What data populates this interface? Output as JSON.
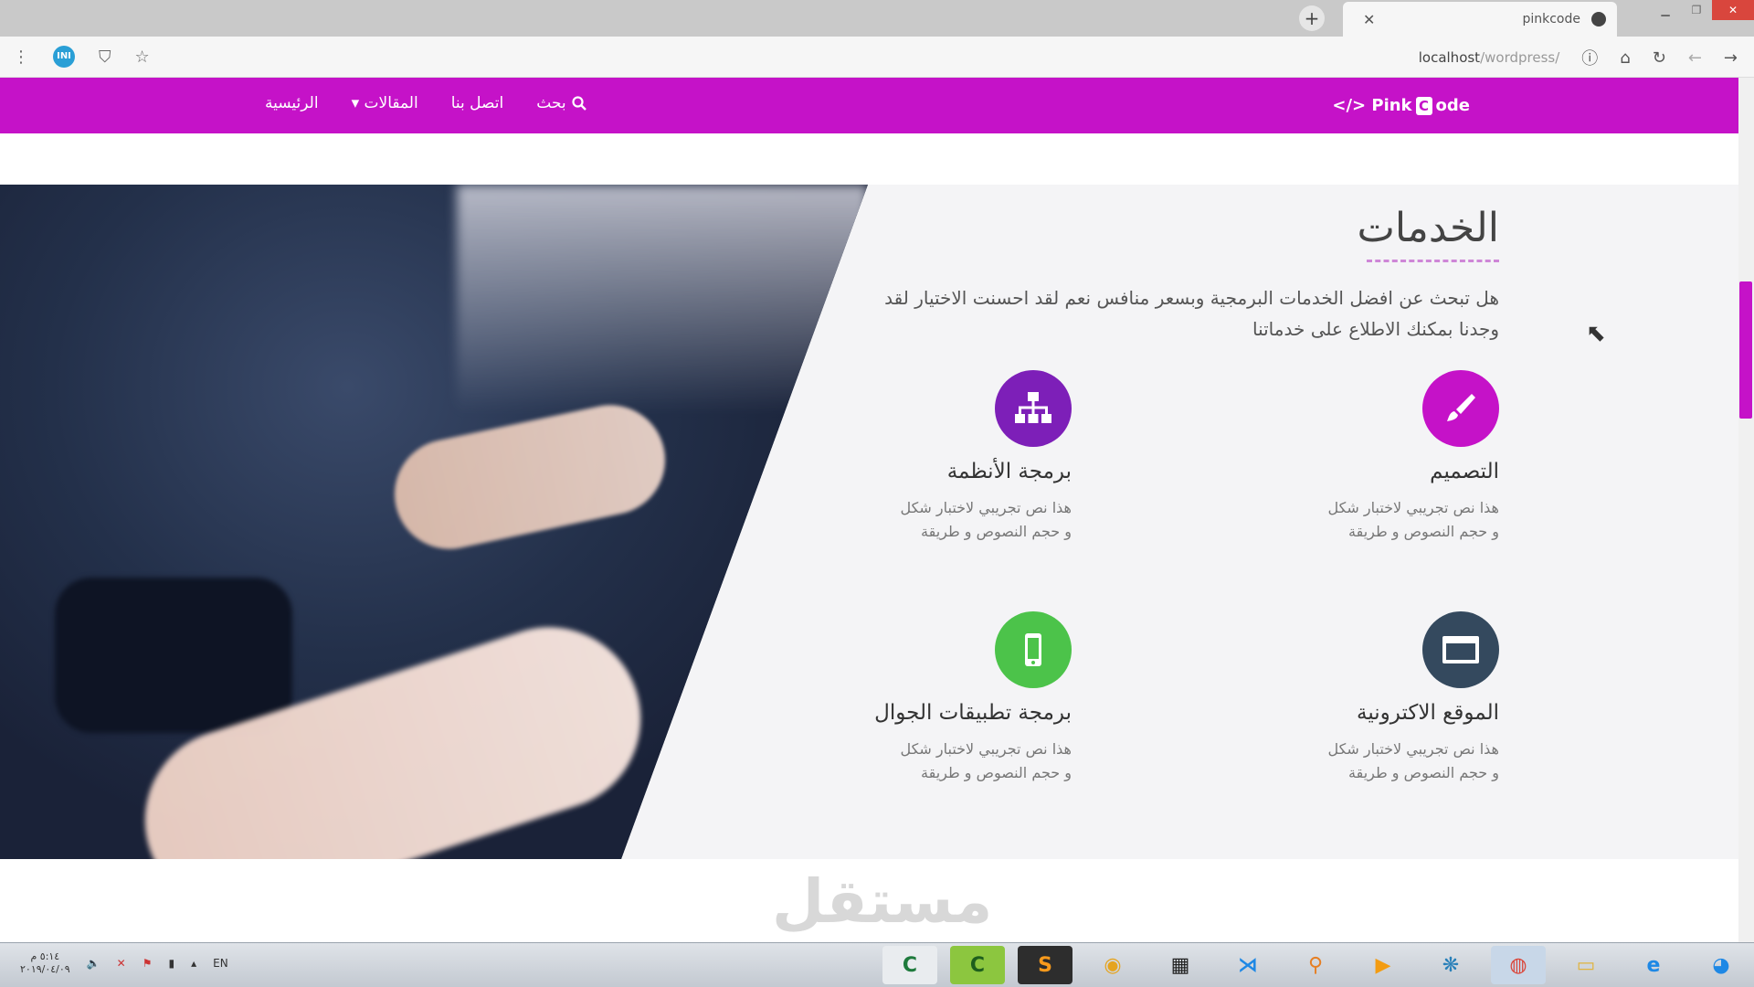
{
  "browser": {
    "tab_title": "pinkcode",
    "tab_close": "✕",
    "new_tab": "+",
    "url_host": "localhost",
    "url_path": "/wordpress/",
    "ext_badge": "INI"
  },
  "navbar": {
    "logo_prefix": "</> Pink ",
    "logo_c": "C",
    "logo_suffix": "ode",
    "home": "الرئيسية",
    "articles": "المقالات ▾",
    "contact": "اتصل بنا",
    "search": "بحث"
  },
  "services": {
    "title": "الخدمات",
    "description": "هل تبحث عن افضل الخدمات البرمجية وبسعر منافس نعم لقد احسنت الاختيار لقد وجدنا بمكنك الاطلاع على خدماتنا",
    "cards": [
      {
        "title": "التصميم",
        "text": "هذا نص تجريبي لاختبار شكل و حجم النصوص و طريقة",
        "icon": "paintbrush-icon",
        "color": "#c512c8"
      },
      {
        "title": "برمجة الأنظمة",
        "text": "هذا نص تجريبي لاختبار شكل و حجم النصوص و طريقة",
        "icon": "sitemap-icon",
        "color": "#7d1fb8"
      },
      {
        "title": "الموقع الاكترونية",
        "text": "هذا نص تجريبي لاختبار شكل و حجم النصوص و طريقة",
        "icon": "browser-window-icon",
        "color": "#34495e"
      },
      {
        "title": "برمجة تطبيقات الجوال",
        "text": "هذا نص تجريبي لاختبار شكل و حجم النصوص و طريقة",
        "icon": "mobile-phone-icon",
        "color": "#4cc34a"
      }
    ]
  },
  "watermark": "مستقل",
  "taskbar": {
    "lang": "EN",
    "time": "٥:١٤ م",
    "date": "٢٠١٩/٠٤/٠٩"
  }
}
